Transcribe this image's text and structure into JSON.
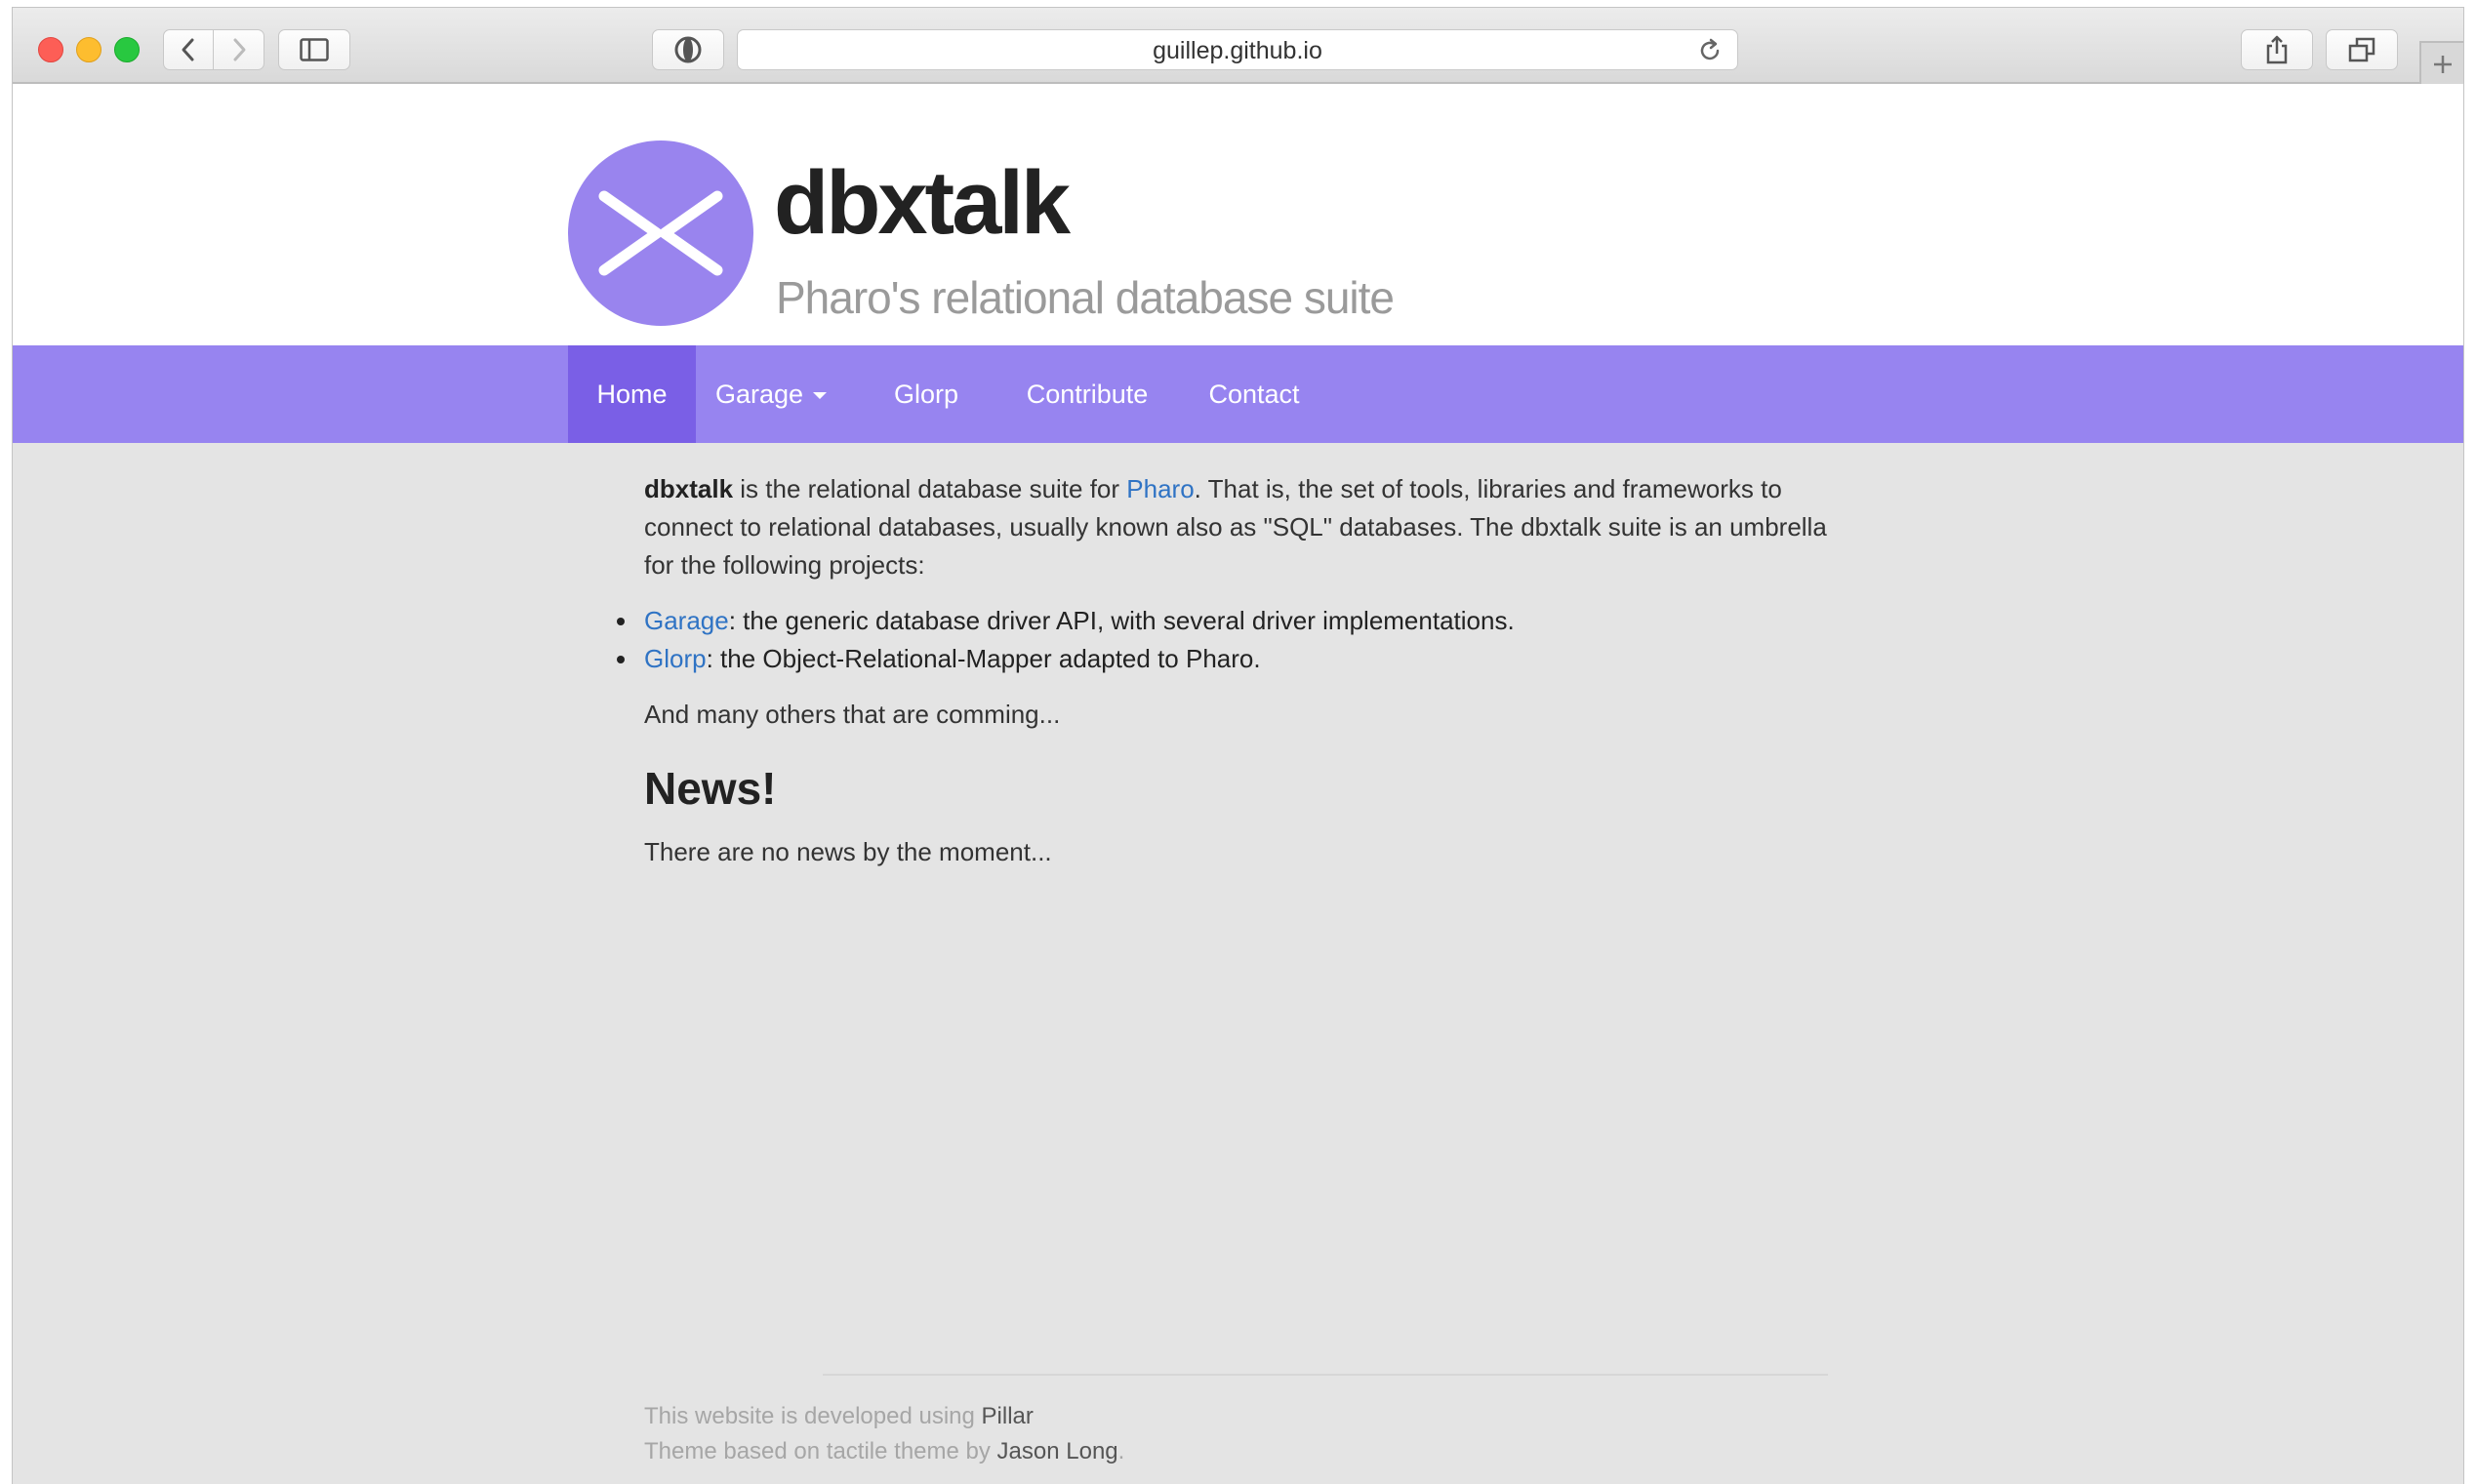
{
  "browser": {
    "url": "guillep.github.io",
    "icons": {
      "back": "chevron-left-icon",
      "forward": "chevron-right-icon",
      "sidebar": "sidebar-icon",
      "privacy": "privacy-icon",
      "reload": "reload-icon",
      "share": "share-icon",
      "tabs": "tabs-overview-icon",
      "new_tab": "plus-icon"
    }
  },
  "header": {
    "title": "dbxtalk",
    "tagline": "Pharo's relational database suite",
    "logo_icon": "dbxtalk-logo-icon"
  },
  "nav": {
    "items": [
      {
        "label": "Home",
        "active": true
      },
      {
        "label": "Garage",
        "dropdown": true
      },
      {
        "label": "Glorp"
      },
      {
        "label": "Contribute"
      },
      {
        "label": "Contact"
      }
    ]
  },
  "content": {
    "intro": {
      "bold": "dbxtalk",
      "text1": " is the relational database suite for ",
      "link": "Pharo",
      "text2": ". That is, the set of tools, libraries and frameworks to connect to relational databases, usually known also as \"SQL\" databases. The dbxtalk suite is an umbrella for the following projects:"
    },
    "projects": [
      {
        "link": "Garage",
        "text": ": the generic database driver API, with several driver implementations."
      },
      {
        "link": "Glorp",
        "text": ": the Object-Relational-Mapper adapted to Pharo."
      }
    ],
    "more": "And many others that are comming...",
    "news_heading": "News!",
    "news_text": "There are no news by the moment..."
  },
  "footer": {
    "line1_text": "This website is developed using ",
    "line1_link": "Pillar",
    "line2_text": "Theme based on tactile theme by ",
    "line2_link": "Jason Long",
    "line2_end": "."
  },
  "colors": {
    "nav_bg": "#9784f0",
    "nav_active": "#7a5fe6",
    "logo": "#9984ee",
    "link": "#2f73c4"
  }
}
